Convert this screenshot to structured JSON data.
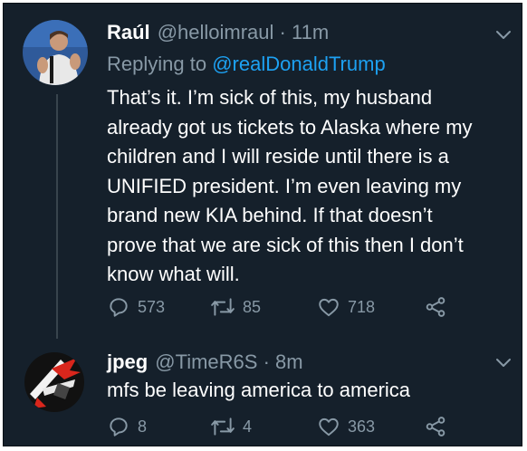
{
  "tweets": [
    {
      "name": "Raúl",
      "handle": "@helloimraul",
      "sep": "·",
      "time": "11m",
      "reply_prefix": "Replying to",
      "reply_to": "@realDonaldTrump",
      "text_lines": [
        "That’s it. I’m sick of this, my husband",
        "already got us tickets to Alaska where my",
        "children and I will reside until there is a",
        "UNIFIED president. I’m even leaving my",
        "brand new KIA behind. If that doesn’t",
        "prove that we are sick of this then I don’t",
        "know what will."
      ],
      "replies": "573",
      "retweets": "85",
      "likes": "718"
    },
    {
      "name": "jpeg",
      "handle": "@TimeR6S",
      "sep": "·",
      "time": "8m",
      "text_lines": [
        "mfs be leaving america to america"
      ],
      "replies": "8",
      "retweets": "4",
      "likes": "363"
    }
  ],
  "colors": {
    "background": "#15202b",
    "text": "#ffffff",
    "muted": "#8899a6",
    "link": "#1da1f2",
    "thread_line": "#38444d"
  },
  "icons": [
    "reply-icon",
    "retweet-icon",
    "like-icon",
    "share-icon",
    "chevron-down-icon"
  ]
}
